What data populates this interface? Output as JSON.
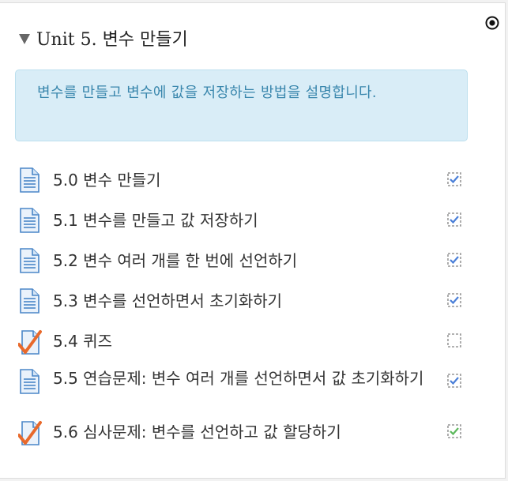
{
  "section": {
    "title": "Unit 5. 변수 만들기",
    "summary": "변수를 만들고 변수에 값을 저장하는 방법을 설명합니다.",
    "activities": [
      {
        "label": "5.0 변수 만들기",
        "icon": "page-icon",
        "completed": true
      },
      {
        "label": "5.1 변수를 만들고 값 저장하기",
        "icon": "page-icon",
        "completed": true
      },
      {
        "label": "5.2 변수 여러 개를 한 번에 선언하기",
        "icon": "page-icon",
        "completed": true
      },
      {
        "label": "5.3 변수를 선언하면서 초기화하기",
        "icon": "page-icon",
        "completed": true
      },
      {
        "label": "5.4 퀴즈",
        "icon": "quiz-icon",
        "completed": false
      },
      {
        "label": "5.5 연습문제: 변수 여러 개를 선언하면서 값 초기화하기",
        "icon": "page-icon",
        "completed": true
      },
      {
        "label": "5.6 심사문제: 변수를 선언하고 값 할당하기",
        "icon": "quiz-icon",
        "completed": true,
        "passed": true
      }
    ]
  },
  "colors": {
    "summary_bg": "#d9edf7",
    "summary_text": "#3a87ad",
    "check_blue": "#4a7fd8",
    "check_green": "#5cb85c",
    "quiz_orange": "#e8692b"
  }
}
